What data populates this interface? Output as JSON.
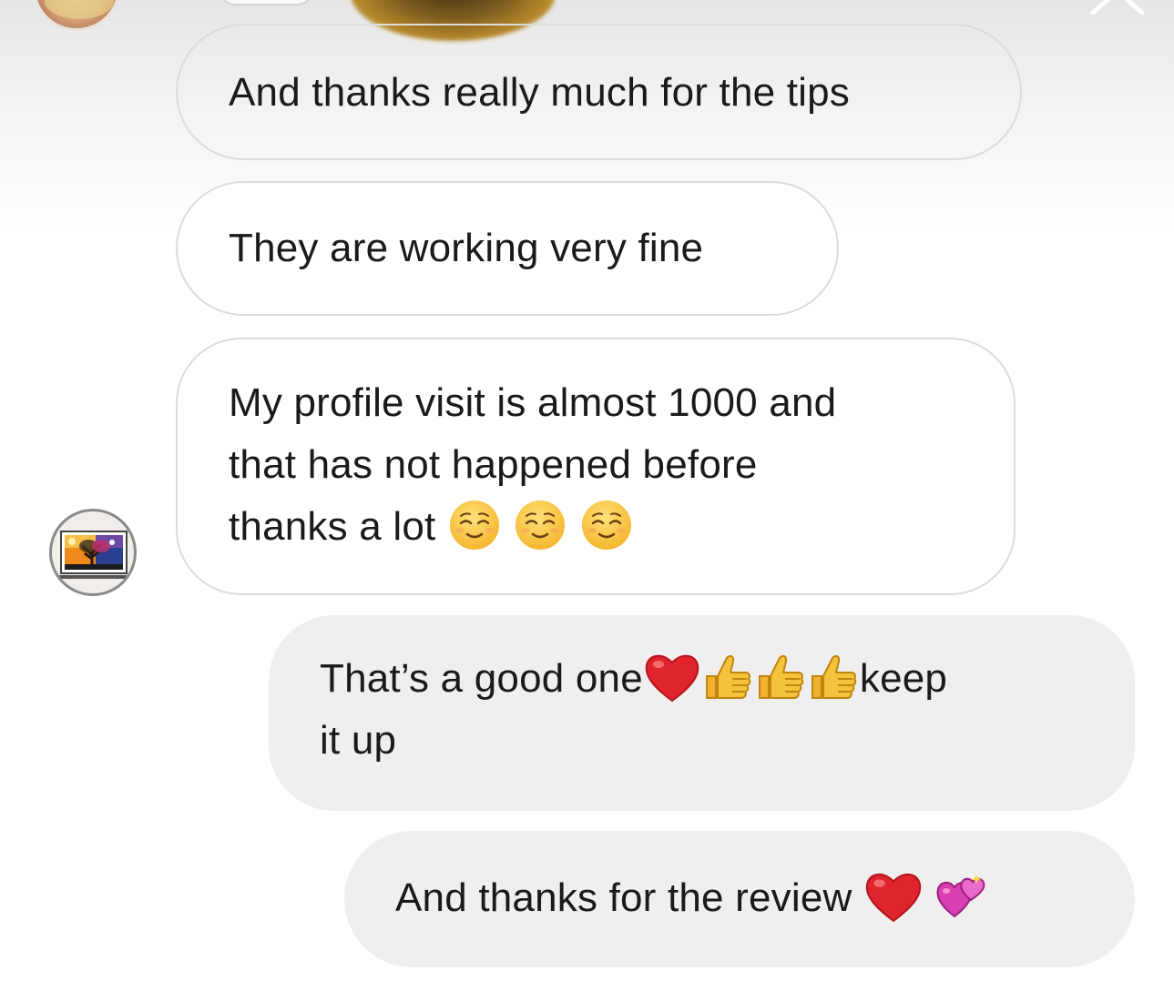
{
  "conversation": {
    "messages": [
      {
        "direction": "received",
        "lines": [
          "And thanks really much for the tips"
        ]
      },
      {
        "direction": "received",
        "lines": [
          "They are working very fine"
        ]
      },
      {
        "direction": "received",
        "lines": [
          "My profile visit is almost 1000 and",
          "that has not happened before",
          "thanks a lot"
        ],
        "emojis": [
          "smiling-face-icon",
          "smiling-face-icon",
          "smiling-face-icon"
        ]
      },
      {
        "direction": "sent",
        "lines": [
          "That’s a good one",
          "keep",
          "it up"
        ],
        "emojis": [
          "red-heart-icon",
          "thumbs-up-icon",
          "thumbs-up-icon",
          "thumbs-up-icon"
        ]
      },
      {
        "direction": "sent",
        "lines": [
          "And thanks for the review"
        ],
        "emojis": [
          "red-heart-icon",
          "two-hearts-icon"
        ]
      }
    ]
  },
  "colors": {
    "sent_bubble": "#efefef",
    "received_border": "#dcdcdc",
    "heart": "#e0242d",
    "thumbs": "#f5c23b"
  }
}
